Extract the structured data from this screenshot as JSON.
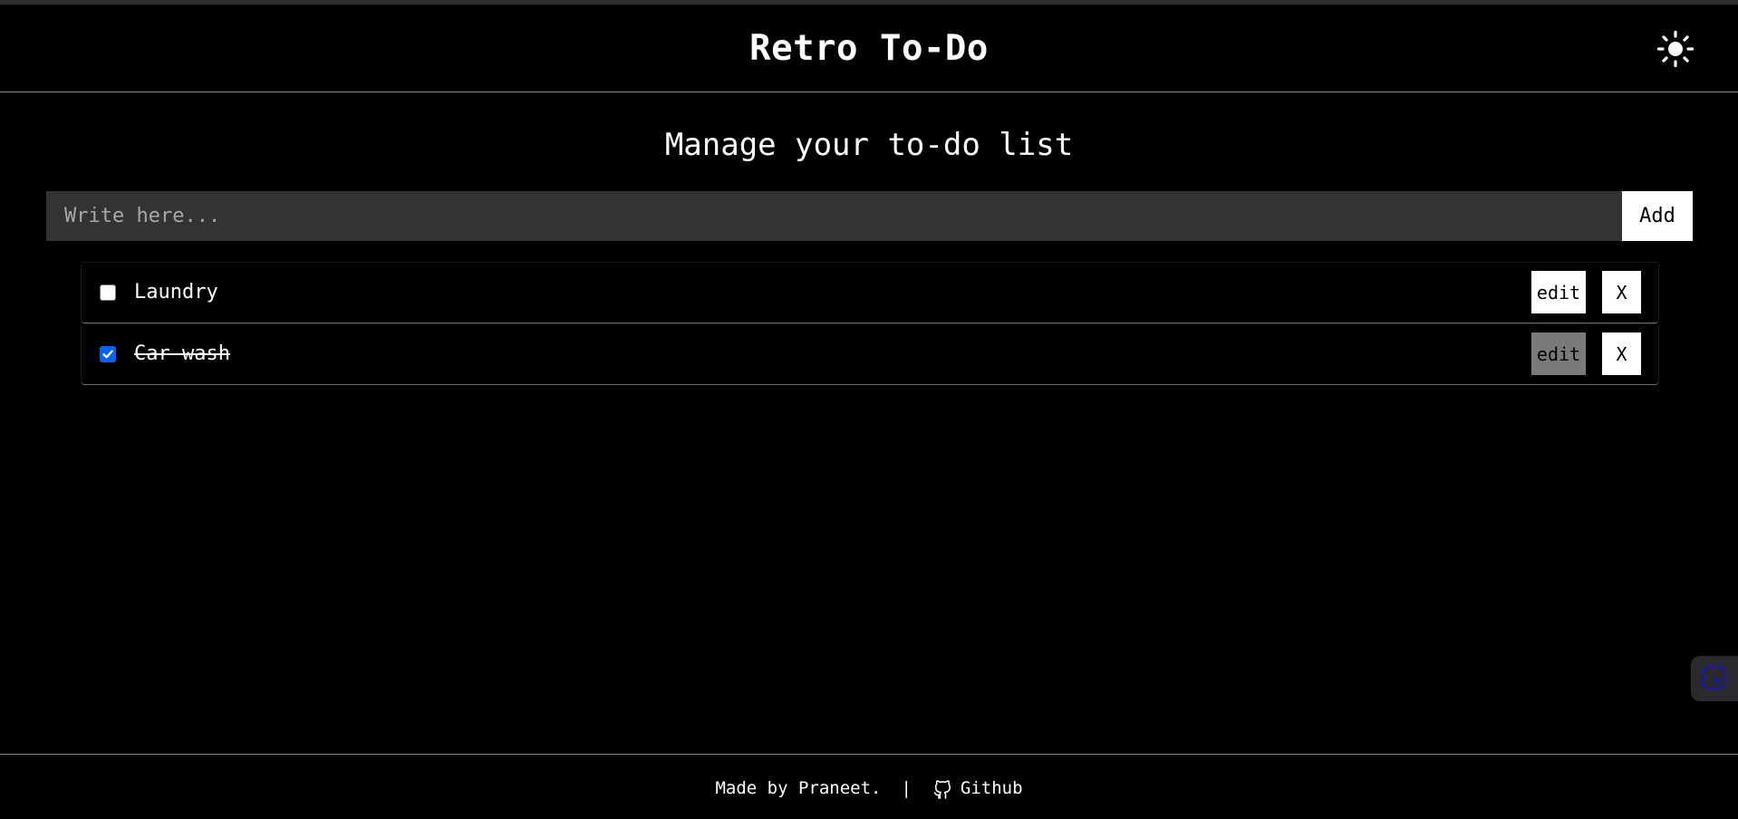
{
  "header": {
    "title": "Retro To-Do",
    "theme_icon": "sun-icon"
  },
  "main": {
    "subtitle": "Manage your to-do list",
    "input": {
      "placeholder": "Write here...",
      "value": ""
    },
    "add_label": "Add"
  },
  "todos": [
    {
      "text": "Laundry",
      "done": false,
      "edit_label": "edit",
      "delete_label": "X"
    },
    {
      "text": "Car wash",
      "done": true,
      "edit_label": "edit",
      "delete_label": "X"
    }
  ],
  "footer": {
    "credit": "Made by Praneet.",
    "separator": "|",
    "github_label": "Github",
    "github_icon": "github-icon"
  },
  "colors": {
    "background": "#000000",
    "input_bg": "#333333",
    "checkbox_checked": "#0b62ef",
    "edit_disabled": "#7a7a7a"
  }
}
